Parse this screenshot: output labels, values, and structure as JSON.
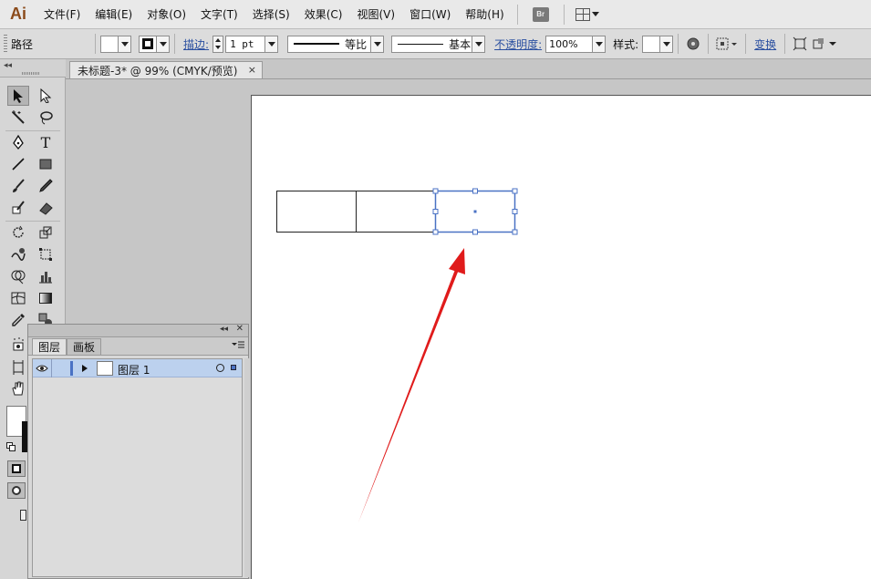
{
  "app": {
    "logo": "Ai"
  },
  "menu": [
    "文件(F)",
    "编辑(E)",
    "对象(O)",
    "文字(T)",
    "选择(S)",
    "效果(C)",
    "视图(V)",
    "窗口(W)",
    "帮助(H)"
  ],
  "menu_br": "Br",
  "control": {
    "selection_label": "路径",
    "stroke_label": "描边:",
    "stroke_weight": "1 pt",
    "profile_label": "等比",
    "brush_label": "基本",
    "opacity_label": "不透明度:",
    "opacity_value": "100%",
    "style_label": "样式:",
    "transform_label": "变换"
  },
  "document": {
    "tab_title": "未标题-3* @ 99% (CMYK/预览)",
    "close": "×"
  },
  "layers_panel": {
    "tabs": [
      "图层",
      "画板"
    ],
    "layers": [
      {
        "name": "图层 1"
      }
    ]
  },
  "colors": {
    "selection_blue": "#4a72c4",
    "arrow_red": "#e01b1b",
    "logo": "#8b4a1a"
  }
}
